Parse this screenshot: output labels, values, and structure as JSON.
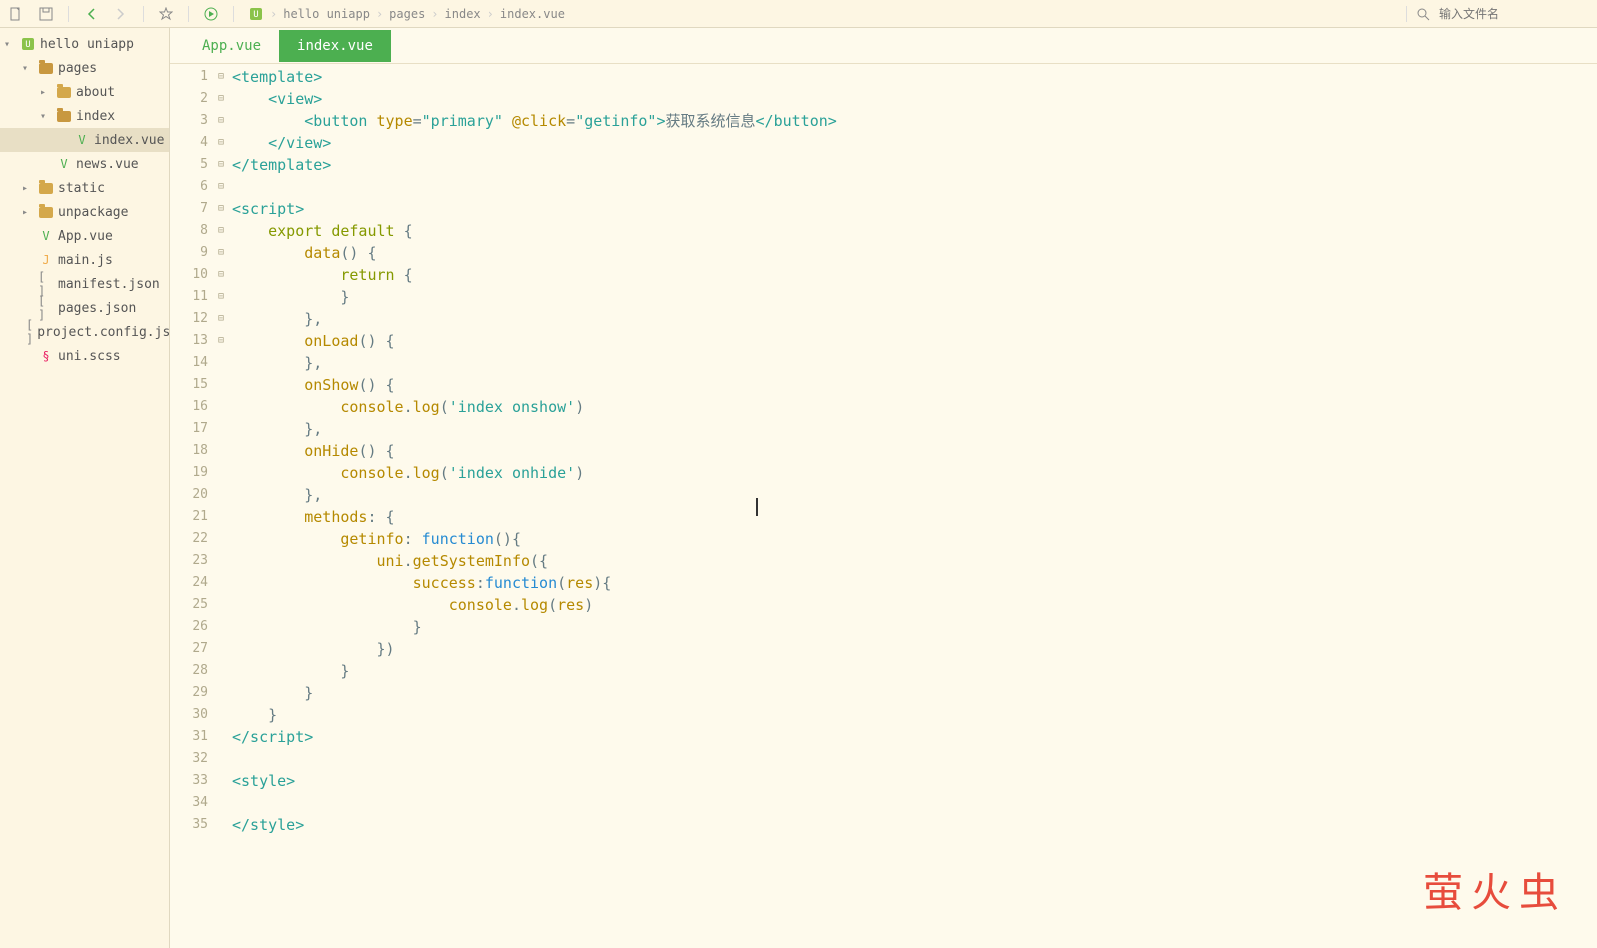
{
  "toolbar": {
    "search_placeholder": "输入文件名"
  },
  "breadcrumbs": [
    "hello uniapp",
    "pages",
    "index",
    "index.vue"
  ],
  "sidebar": {
    "root": "hello uniapp",
    "items": [
      {
        "label": "pages",
        "type": "folder",
        "depth": 1,
        "open": true,
        "expanded": true
      },
      {
        "label": "about",
        "type": "folder",
        "depth": 2,
        "open": false,
        "expanded": false
      },
      {
        "label": "index",
        "type": "folder",
        "depth": 2,
        "open": true,
        "expanded": true
      },
      {
        "label": "index.vue",
        "type": "vue",
        "depth": 3,
        "selected": true
      },
      {
        "label": "news.vue",
        "type": "vue",
        "depth": 2
      },
      {
        "label": "static",
        "type": "folder",
        "depth": 1,
        "open": false,
        "expanded": false
      },
      {
        "label": "unpackage",
        "type": "folder",
        "depth": 1,
        "open": false,
        "expanded": false
      },
      {
        "label": "App.vue",
        "type": "vue",
        "depth": 1
      },
      {
        "label": "main.js",
        "type": "js",
        "depth": 1
      },
      {
        "label": "manifest.json",
        "type": "json",
        "depth": 1
      },
      {
        "label": "pages.json",
        "type": "json",
        "depth": 1
      },
      {
        "label": "project.config.json",
        "type": "json",
        "depth": 1
      },
      {
        "label": "uni.scss",
        "type": "scss",
        "depth": 1
      }
    ]
  },
  "tabs": [
    {
      "label": "App.vue",
      "active": false
    },
    {
      "label": "index.vue",
      "active": true
    }
  ],
  "code": {
    "lines": [
      {
        "n": 1,
        "fold": "⊟",
        "tokens": [
          {
            "c": "tag",
            "t": "<template>"
          }
        ]
      },
      {
        "n": 2,
        "fold": "⊟",
        "tokens": [
          {
            "c": "",
            "t": "    "
          },
          {
            "c": "tag",
            "t": "<view>"
          }
        ]
      },
      {
        "n": 3,
        "fold": "",
        "tokens": [
          {
            "c": "",
            "t": "        "
          },
          {
            "c": "tag",
            "t": "<button"
          },
          {
            "c": "",
            "t": " "
          },
          {
            "c": "attr",
            "t": "type"
          },
          {
            "c": "punc",
            "t": "="
          },
          {
            "c": "str",
            "t": "\"primary\""
          },
          {
            "c": "",
            "t": " "
          },
          {
            "c": "attr",
            "t": "@click"
          },
          {
            "c": "punc",
            "t": "="
          },
          {
            "c": "str",
            "t": "\"getinfo\""
          },
          {
            "c": "tag",
            "t": ">"
          },
          {
            "c": "txt",
            "t": "获取系统信息"
          },
          {
            "c": "tag",
            "t": "</button>"
          }
        ]
      },
      {
        "n": 4,
        "fold": "",
        "tokens": [
          {
            "c": "",
            "t": "    "
          },
          {
            "c": "tag",
            "t": "</view>"
          }
        ]
      },
      {
        "n": 5,
        "fold": "",
        "tokens": [
          {
            "c": "tag",
            "t": "</template>"
          }
        ]
      },
      {
        "n": 6,
        "fold": "",
        "tokens": [
          {
            "c": "",
            "t": ""
          }
        ]
      },
      {
        "n": 7,
        "fold": "⊟",
        "tokens": [
          {
            "c": "tag",
            "t": "<script>"
          }
        ]
      },
      {
        "n": 8,
        "fold": "⊟",
        "tokens": [
          {
            "c": "",
            "t": "    "
          },
          {
            "c": "kw",
            "t": "export"
          },
          {
            "c": "",
            "t": " "
          },
          {
            "c": "kw",
            "t": "default"
          },
          {
            "c": "",
            "t": " "
          },
          {
            "c": "punc",
            "t": "{"
          }
        ]
      },
      {
        "n": 9,
        "fold": "⊟",
        "tokens": [
          {
            "c": "",
            "t": "        "
          },
          {
            "c": "fn",
            "t": "data"
          },
          {
            "c": "punc",
            "t": "() "
          },
          {
            "c": "punc",
            "t": "{"
          }
        ]
      },
      {
        "n": 10,
        "fold": "",
        "tokens": [
          {
            "c": "",
            "t": "            "
          },
          {
            "c": "kw",
            "t": "return"
          },
          {
            "c": "",
            "t": " "
          },
          {
            "c": "punc",
            "t": "{"
          }
        ]
      },
      {
        "n": 11,
        "fold": "",
        "tokens": [
          {
            "c": "",
            "t": "            "
          },
          {
            "c": "punc",
            "t": "}"
          }
        ]
      },
      {
        "n": 12,
        "fold": "",
        "tokens": [
          {
            "c": "",
            "t": "        "
          },
          {
            "c": "punc",
            "t": "},"
          }
        ]
      },
      {
        "n": 13,
        "fold": "⊟",
        "tokens": [
          {
            "c": "",
            "t": "        "
          },
          {
            "c": "fn",
            "t": "onLoad"
          },
          {
            "c": "punc",
            "t": "() {"
          }
        ]
      },
      {
        "n": 14,
        "fold": "",
        "tokens": [
          {
            "c": "",
            "t": "        "
          },
          {
            "c": "punc",
            "t": "},"
          }
        ]
      },
      {
        "n": 15,
        "fold": "⊟",
        "tokens": [
          {
            "c": "",
            "t": "        "
          },
          {
            "c": "fn",
            "t": "onShow"
          },
          {
            "c": "punc",
            "t": "() {"
          }
        ]
      },
      {
        "n": 16,
        "fold": "",
        "tokens": [
          {
            "c": "",
            "t": "            "
          },
          {
            "c": "ident",
            "t": "console"
          },
          {
            "c": "punc",
            "t": "."
          },
          {
            "c": "fn",
            "t": "log"
          },
          {
            "c": "punc",
            "t": "("
          },
          {
            "c": "str",
            "t": "'index onshow'"
          },
          {
            "c": "punc",
            "t": ")"
          }
        ]
      },
      {
        "n": 17,
        "fold": "",
        "tokens": [
          {
            "c": "",
            "t": "        "
          },
          {
            "c": "punc",
            "t": "},"
          }
        ]
      },
      {
        "n": 18,
        "fold": "⊟",
        "tokens": [
          {
            "c": "",
            "t": "        "
          },
          {
            "c": "fn",
            "t": "onHide"
          },
          {
            "c": "punc",
            "t": "() {"
          }
        ]
      },
      {
        "n": 19,
        "fold": "",
        "tokens": [
          {
            "c": "",
            "t": "            "
          },
          {
            "c": "ident",
            "t": "console"
          },
          {
            "c": "punc",
            "t": "."
          },
          {
            "c": "fn",
            "t": "log"
          },
          {
            "c": "punc",
            "t": "("
          },
          {
            "c": "str",
            "t": "'index onhide'"
          },
          {
            "c": "punc",
            "t": ")"
          }
        ]
      },
      {
        "n": 20,
        "fold": "",
        "tokens": [
          {
            "c": "",
            "t": "        "
          },
          {
            "c": "punc",
            "t": "},"
          }
        ]
      },
      {
        "n": 21,
        "fold": "⊟",
        "tokens": [
          {
            "c": "",
            "t": "        "
          },
          {
            "c": "ident",
            "t": "methods"
          },
          {
            "c": "punc",
            "t": ": {"
          }
        ]
      },
      {
        "n": 22,
        "fold": "⊟",
        "tokens": [
          {
            "c": "",
            "t": "            "
          },
          {
            "c": "ident",
            "t": "getinfo"
          },
          {
            "c": "punc",
            "t": ": "
          },
          {
            "c": "kw2",
            "t": "function"
          },
          {
            "c": "punc",
            "t": "(){"
          }
        ]
      },
      {
        "n": 23,
        "fold": "⊟",
        "tokens": [
          {
            "c": "",
            "t": "                "
          },
          {
            "c": "ident",
            "t": "uni"
          },
          {
            "c": "punc",
            "t": "."
          },
          {
            "c": "fn",
            "t": "getSystemInfo"
          },
          {
            "c": "punc",
            "t": "({"
          }
        ]
      },
      {
        "n": 24,
        "fold": "⊟",
        "tokens": [
          {
            "c": "",
            "t": "                    "
          },
          {
            "c": "ident",
            "t": "success"
          },
          {
            "c": "punc",
            "t": ":"
          },
          {
            "c": "kw2",
            "t": "function"
          },
          {
            "c": "punc",
            "t": "("
          },
          {
            "c": "ident",
            "t": "res"
          },
          {
            "c": "punc",
            "t": "){"
          }
        ]
      },
      {
        "n": 25,
        "fold": "",
        "tokens": [
          {
            "c": "",
            "t": "                        "
          },
          {
            "c": "ident",
            "t": "console"
          },
          {
            "c": "punc",
            "t": "."
          },
          {
            "c": "fn",
            "t": "log"
          },
          {
            "c": "punc",
            "t": "("
          },
          {
            "c": "ident",
            "t": "res"
          },
          {
            "c": "punc",
            "t": ")"
          }
        ]
      },
      {
        "n": 26,
        "fold": "",
        "tokens": [
          {
            "c": "",
            "t": "                    "
          },
          {
            "c": "punc",
            "t": "}"
          }
        ]
      },
      {
        "n": 27,
        "fold": "",
        "tokens": [
          {
            "c": "",
            "t": "                "
          },
          {
            "c": "punc",
            "t": "})"
          }
        ]
      },
      {
        "n": 28,
        "fold": "",
        "tokens": [
          {
            "c": "",
            "t": "            "
          },
          {
            "c": "punc",
            "t": "}"
          }
        ]
      },
      {
        "n": 29,
        "fold": "",
        "tokens": [
          {
            "c": "",
            "t": "        "
          },
          {
            "c": "punc",
            "t": "}"
          }
        ]
      },
      {
        "n": 30,
        "fold": "",
        "tokens": [
          {
            "c": "",
            "t": "    "
          },
          {
            "c": "punc",
            "t": "}"
          }
        ]
      },
      {
        "n": 31,
        "fold": "",
        "tokens": [
          {
            "c": "tag",
            "t": "</script>"
          }
        ]
      },
      {
        "n": 32,
        "fold": "",
        "tokens": [
          {
            "c": "",
            "t": ""
          }
        ]
      },
      {
        "n": 33,
        "fold": "⊟",
        "tokens": [
          {
            "c": "tag",
            "t": "<style>"
          }
        ]
      },
      {
        "n": 34,
        "fold": "",
        "tokens": [
          {
            "c": "",
            "t": ""
          }
        ]
      },
      {
        "n": 35,
        "fold": "",
        "tokens": [
          {
            "c": "tag",
            "t": "</style>"
          }
        ]
      }
    ]
  },
  "watermark": "萤火虫"
}
